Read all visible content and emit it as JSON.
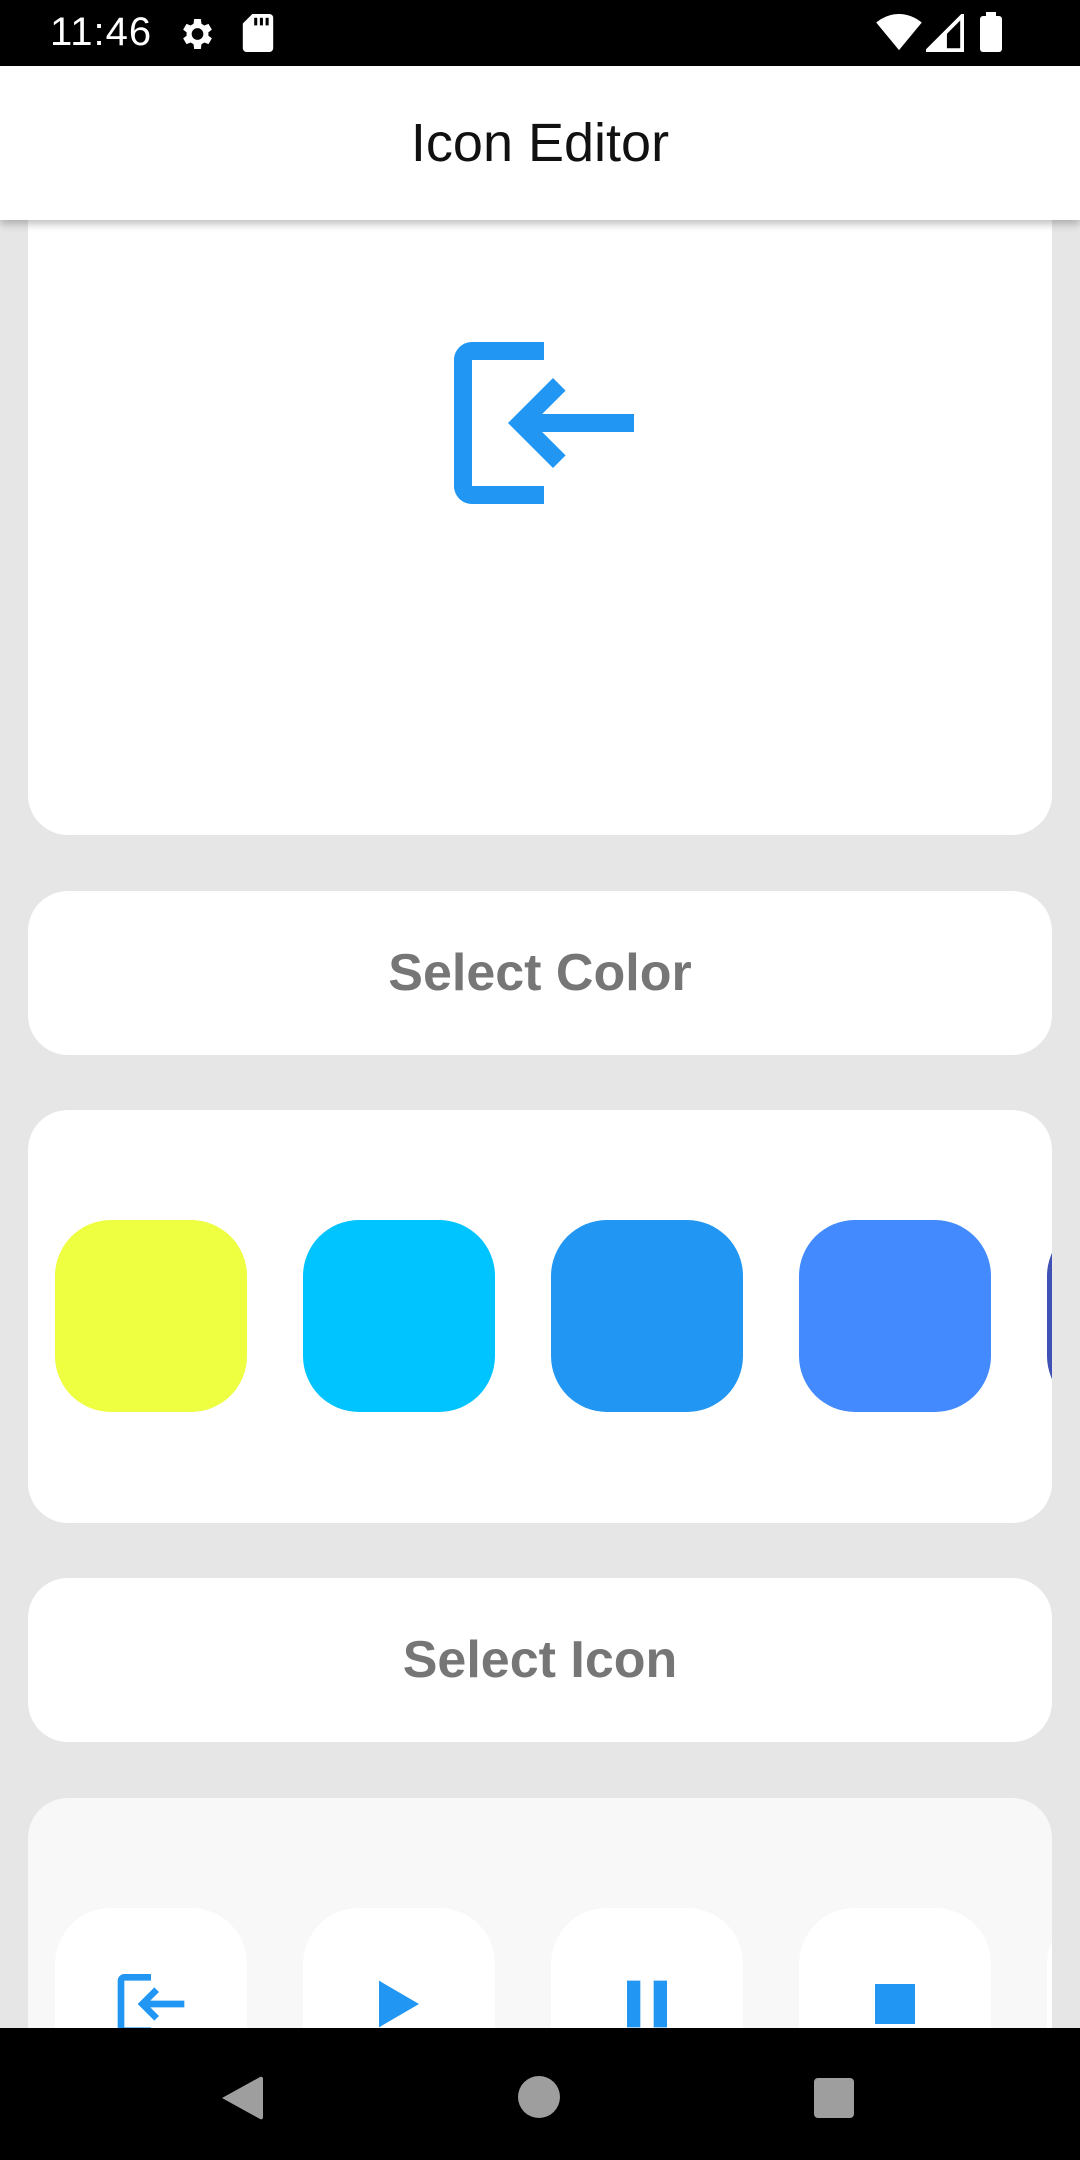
{
  "status_bar": {
    "time": "11:46",
    "icons": [
      "gear-icon",
      "sd-card-icon",
      "wifi-icon",
      "signal-icon",
      "battery-icon"
    ]
  },
  "app_bar": {
    "title": "Icon Editor"
  },
  "preview": {
    "icon": "login-icon",
    "color": "#2196F3"
  },
  "select_color": {
    "label": "Select Color"
  },
  "palette": {
    "swatches": [
      "#EEFF41",
      "#00C4FF",
      "#2196F3",
      "#448AFF",
      "#3F51B5"
    ]
  },
  "select_icon": {
    "label": "Select Icon"
  },
  "icon_options": {
    "icons": [
      "login-icon",
      "play-icon",
      "pause-icon",
      "stop-icon"
    ],
    "color": "#2196F3"
  },
  "nav_bar": {
    "icons": [
      "back-icon",
      "home-icon",
      "recents-icon"
    ]
  }
}
